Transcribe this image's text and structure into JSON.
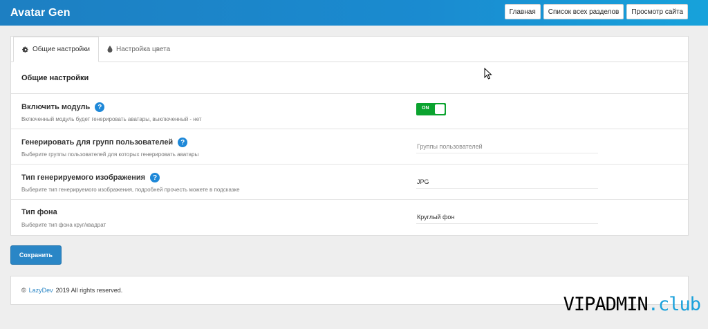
{
  "app": {
    "title": "Avatar Gen"
  },
  "header": {
    "buttons": [
      {
        "label": "Главная"
      },
      {
        "label": "Список всех разделов"
      },
      {
        "label": "Просмотр сайта"
      }
    ]
  },
  "tabs": [
    {
      "label": "Общие настройки",
      "icon": "gear-icon",
      "active": true
    },
    {
      "label": "Настройка цвета",
      "icon": "drop-icon",
      "active": false
    }
  ],
  "section": {
    "title": "Общие настройки"
  },
  "settings": [
    {
      "label": "Включить модуль",
      "description": "Включенный модуль будет генерировать аватары, выключенный - нет",
      "control": "toggle",
      "value": "ON"
    },
    {
      "label": "Генерировать для групп пользователей",
      "description": "Выберите группы пользователей для которых генерировать аватары",
      "control": "multiselect",
      "placeholder": "Группы пользователей"
    },
    {
      "label": "Тип генерируемого изображения",
      "description": "Выберите тип генерируемого изображения, подробней прочесть можете в подсказке",
      "control": "select",
      "value": "JPG"
    },
    {
      "label": "Тип фона",
      "description": "Выберите тип фона круг/квадрат",
      "control": "select",
      "value": "Круглый фон"
    }
  ],
  "save_label": "Сохранить",
  "footer": {
    "copyright_symbol": "©",
    "link_text": "LazyDev",
    "rest": "2019 All rights reserved."
  },
  "watermark": {
    "main": "VIPADMIN",
    "dot": ".",
    "suffix": "club"
  },
  "colors": {
    "header_gradient_start": "#1d7fc2",
    "header_gradient_end": "#17a2db",
    "toggle_on": "#0ba32f",
    "help_icon": "#1e88d8",
    "save_button": "#2a86c6",
    "watermark_accent": "#1aa1db"
  }
}
